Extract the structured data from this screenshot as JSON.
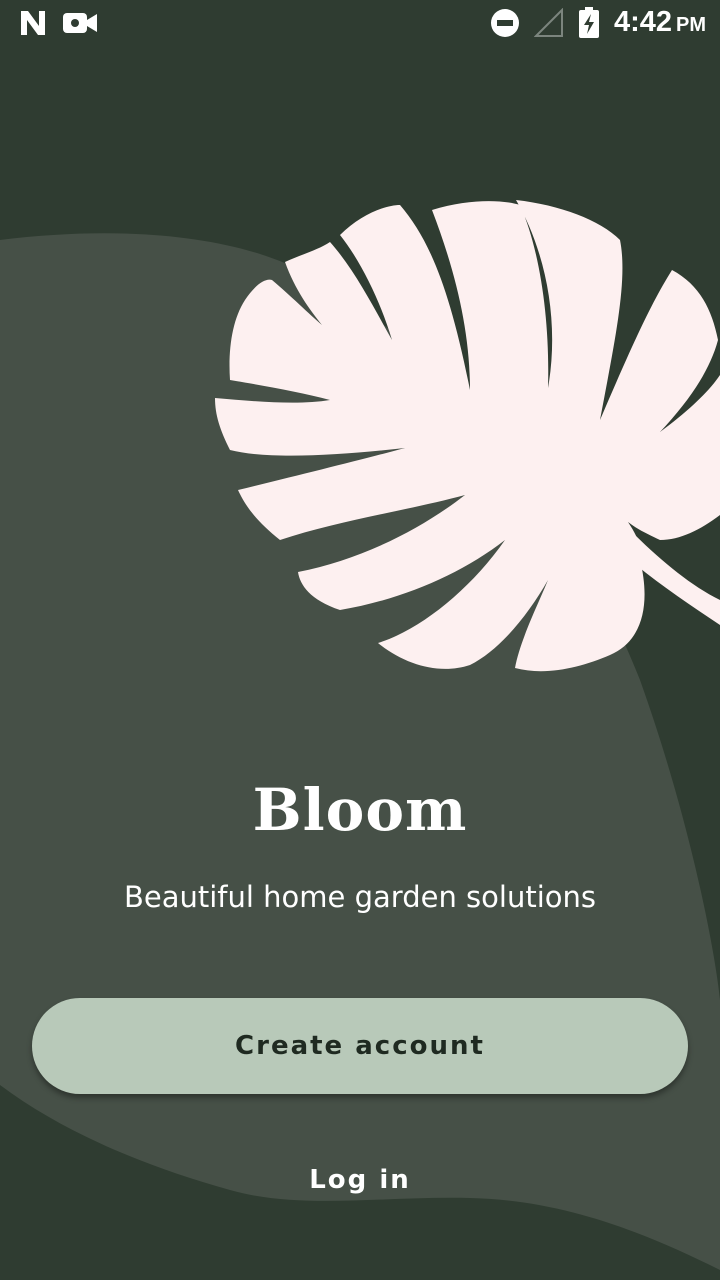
{
  "status_bar": {
    "time": "4:42",
    "time_suffix": "PM",
    "icons": [
      "n-notification-icon",
      "video-camera-icon",
      "do-not-disturb-icon",
      "signal-icon",
      "battery-charging-icon"
    ]
  },
  "colors": {
    "background_dark": "#2f3c31",
    "background_curve": "#465047",
    "leaf": "#fdf0f0",
    "button_primary": "#b8c9b9",
    "button_text": "#1f2a21",
    "text_light": "#ffffff"
  },
  "hero": {
    "illustration": "monstera-leaf-icon"
  },
  "main": {
    "title": "Bloom",
    "subtitle": "Beautiful home garden solutions",
    "create_account_label": "Create account",
    "login_label": "Log in"
  }
}
